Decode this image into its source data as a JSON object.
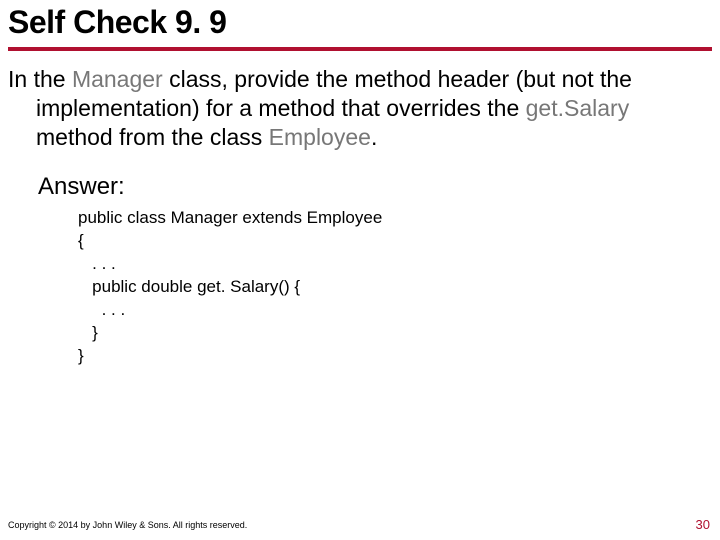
{
  "title": "Self Check 9. 9",
  "question": {
    "pre1": "In the ",
    "mono1": "Manager",
    "mid1": " class, provide the method header (but not the implementation) for a method that overrides the ",
    "mono2": "get.Salary",
    "mid2": " method from the class ",
    "mono3": "Employee",
    "post": "."
  },
  "answer_label": "Answer:",
  "code": "public class Manager extends Employee\n{\n   . . .\n   public double get. Salary() {\n     . . .\n   }\n}",
  "footer": "Copyright © 2014 by John Wiley & Sons. All rights reserved.",
  "page": "30"
}
